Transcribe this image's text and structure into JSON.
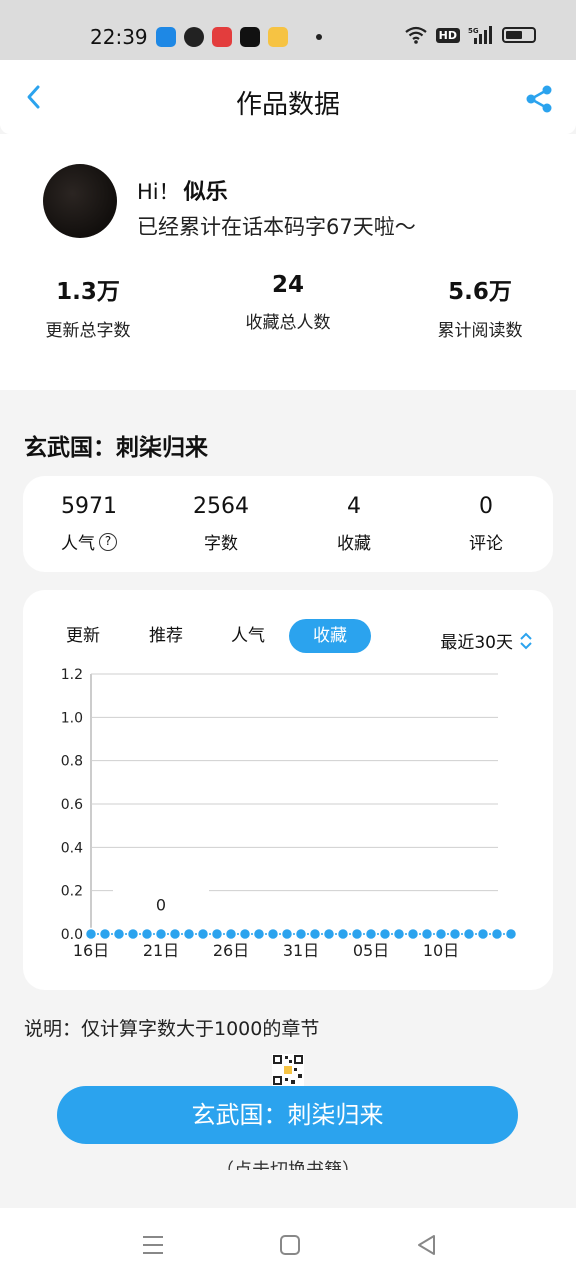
{
  "status_bar": {
    "time": "22:39",
    "notification_icons": [
      "browser-icon",
      "feather-icon",
      "toutiao-icon",
      "tiktok-icon",
      "reader-icon"
    ],
    "badges": [
      "HD",
      "5G"
    ],
    "colors": {
      "toutiao": "#e33d3d",
      "tiktok": "#111111",
      "reader": "#f6c343",
      "browser": "#1e88e5",
      "feather": "#222222"
    }
  },
  "header": {
    "title": "作品数据"
  },
  "profile": {
    "greeting_prefix": "Hi！",
    "name": "似乐",
    "subtitle": "已经累计在话本码字67天啦～",
    "stats": [
      {
        "value": "1.3万",
        "label": "更新总字数"
      },
      {
        "value": "24",
        "label": "收藏总人数"
      },
      {
        "value": "5.6万",
        "label": "累计阅读数"
      }
    ]
  },
  "book": {
    "title": "玄武国：刺柒归来",
    "metrics": [
      {
        "value": "5971",
        "label": "人气"
      },
      {
        "value": "2564",
        "label": "字数"
      },
      {
        "value": "4",
        "label": "收藏"
      },
      {
        "value": "0",
        "label": "评论"
      }
    ]
  },
  "chart_panel": {
    "tabs": [
      "更新",
      "推荐",
      "人气",
      "收藏"
    ],
    "active_tab": "收藏",
    "period": "最近30天",
    "accent": "#2ba3ee"
  },
  "chart_data": {
    "type": "line",
    "y_ticks": [
      "1.2",
      "1.0",
      "0.8",
      "0.6",
      "0.4",
      "0.2",
      "0.0"
    ],
    "ylim": [
      0,
      1.2
    ],
    "x_tick_labels": [
      "16日",
      "21日",
      "26日",
      "31日",
      "05日",
      "10日"
    ],
    "series": [
      {
        "values": [
          0,
          0,
          0,
          0,
          0,
          0,
          0,
          0,
          0,
          0,
          0,
          0,
          0,
          0,
          0,
          0,
          0,
          0,
          0,
          0,
          0,
          0,
          0,
          0,
          0,
          0,
          0,
          0,
          0,
          0,
          0
        ]
      }
    ],
    "tooltip_label": "0",
    "grid": true
  },
  "note": "说明：仅计算字数大于1000的章节",
  "primary_button": "玄武国：刺柒归来",
  "switch_link": "（点击切换书籍）"
}
